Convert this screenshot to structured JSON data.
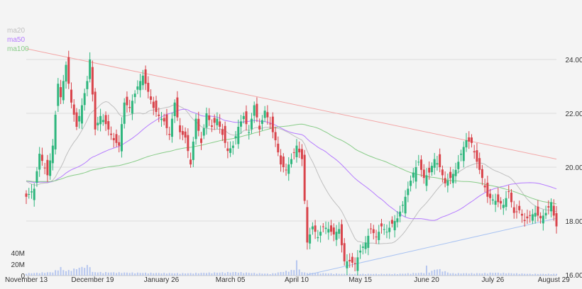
{
  "colors": {
    "background": "#f4f4f4",
    "grid": "#dddddd",
    "up": "#2eb67d",
    "down": "#d9444b",
    "ma20": "#bfbfbf",
    "ma50": "#b57bff",
    "ma100": "#88cc88",
    "trend_upper": "#f3a6a6",
    "trend_lower": "#a9c3f2",
    "volume": "#b7c7ef",
    "axis_text": "#333333"
  },
  "legend": [
    {
      "label": "ma20",
      "color": "#bfbfbf"
    },
    {
      "label": "ma50",
      "color": "#b57bff"
    },
    {
      "label": "ma100",
      "color": "#88cc88"
    }
  ],
  "chart_data": {
    "type": "candlestick",
    "price_axis": {
      "ticks": [
        "24.00",
        "22.00",
        "20.00",
        "18.00",
        "16.00"
      ],
      "ylim": [
        16,
        24.8
      ],
      "position": "right"
    },
    "volume_axis": {
      "ticks": [
        "40M",
        "20M",
        "0"
      ],
      "ylim": [
        0,
        60
      ]
    },
    "x_axis": {
      "labels": [
        "November 13",
        "December 19",
        "January 26",
        "March 05",
        "April 10",
        "May 15",
        "June 20",
        "July 26",
        "August 29"
      ],
      "label_index": [
        0,
        25,
        51,
        77,
        102,
        126,
        151,
        176,
        199
      ],
      "n_days": 201
    },
    "grid": true,
    "anchors_close": [
      [
        0,
        18.9
      ],
      [
        3,
        19.2
      ],
      [
        5,
        20.5
      ],
      [
        8,
        19.7
      ],
      [
        10,
        20.8
      ],
      [
        12,
        23.1
      ],
      [
        13,
        22.6
      ],
      [
        15,
        23.8
      ],
      [
        17,
        22.4
      ],
      [
        19,
        21.5
      ],
      [
        21,
        22.3
      ],
      [
        23,
        23.2
      ],
      [
        24,
        24.0
      ],
      [
        26,
        21.4
      ],
      [
        28,
        21.9
      ],
      [
        30,
        21.6
      ],
      [
        33,
        21.0
      ],
      [
        35,
        20.8
      ],
      [
        37,
        22.4
      ],
      [
        39,
        22.2
      ],
      [
        42,
        23.0
      ],
      [
        44,
        23.4
      ],
      [
        46,
        22.8
      ],
      [
        48,
        22.2
      ],
      [
        50,
        21.9
      ],
      [
        52,
        21.7
      ],
      [
        54,
        21.2
      ],
      [
        56,
        22.4
      ],
      [
        58,
        21.3
      ],
      [
        60,
        21.1
      ],
      [
        62,
        20.1
      ],
      [
        64,
        21.8
      ],
      [
        66,
        20.9
      ],
      [
        68,
        22.0
      ],
      [
        70,
        21.5
      ],
      [
        72,
        21.8
      ],
      [
        74,
        21.2
      ],
      [
        76,
        20.6
      ],
      [
        78,
        20.8
      ],
      [
        80,
        21.5
      ],
      [
        82,
        21.9
      ],
      [
        84,
        21.3
      ],
      [
        86,
        22.3
      ],
      [
        88,
        21.4
      ],
      [
        90,
        22.1
      ],
      [
        92,
        21.6
      ],
      [
        94,
        21.0
      ],
      [
        96,
        20.1
      ],
      [
        98,
        19.9
      ],
      [
        100,
        20.3
      ],
      [
        102,
        20.8
      ],
      [
        104,
        20.3
      ],
      [
        106,
        17.2
      ],
      [
        108,
        17.8
      ],
      [
        110,
        17.4
      ],
      [
        112,
        17.8
      ],
      [
        114,
        17.7
      ],
      [
        116,
        17.5
      ],
      [
        118,
        17.7
      ],
      [
        120,
        16.5
      ],
      [
        122,
        16.5
      ],
      [
        124,
        16.4
      ],
      [
        126,
        16.9
      ],
      [
        128,
        17.2
      ],
      [
        130,
        17.7
      ],
      [
        132,
        17.4
      ],
      [
        134,
        17.8
      ],
      [
        136,
        17.6
      ],
      [
        138,
        17.9
      ],
      [
        140,
        18.1
      ],
      [
        142,
        18.6
      ],
      [
        144,
        19.2
      ],
      [
        146,
        19.8
      ],
      [
        148,
        20.2
      ],
      [
        150,
        19.6
      ],
      [
        152,
        19.8
      ],
      [
        154,
        20.3
      ],
      [
        156,
        20.0
      ],
      [
        158,
        19.4
      ],
      [
        160,
        19.6
      ],
      [
        162,
        19.9
      ],
      [
        164,
        20.5
      ],
      [
        166,
        21.0
      ],
      [
        168,
        20.9
      ],
      [
        170,
        20.2
      ],
      [
        172,
        19.6
      ],
      [
        174,
        18.9
      ],
      [
        176,
        18.8
      ],
      [
        178,
        18.7
      ],
      [
        180,
        18.6
      ],
      [
        182,
        19.1
      ],
      [
        184,
        18.3
      ],
      [
        186,
        18.4
      ],
      [
        188,
        18.0
      ],
      [
        190,
        18.2
      ],
      [
        192,
        18.3
      ],
      [
        194,
        18.1
      ],
      [
        196,
        18.3
      ],
      [
        198,
        18.7
      ],
      [
        199,
        18.2
      ],
      [
        200,
        17.8
      ]
    ],
    "volume_anchors": [
      [
        0,
        4
      ],
      [
        10,
        6
      ],
      [
        13,
        14
      ],
      [
        14,
        10
      ],
      [
        15,
        8
      ],
      [
        24,
        18
      ],
      [
        25,
        6
      ],
      [
        40,
        5
      ],
      [
        60,
        4
      ],
      [
        79,
        6
      ],
      [
        92,
        3
      ],
      [
        101,
        10
      ],
      [
        102,
        28
      ],
      [
        103,
        10
      ],
      [
        105,
        5
      ],
      [
        120,
        3
      ],
      [
        140,
        3
      ],
      [
        150,
        5
      ],
      [
        151,
        16
      ],
      [
        152,
        6
      ],
      [
        155,
        12
      ],
      [
        160,
        4
      ],
      [
        172,
        4
      ],
      [
        176,
        5
      ],
      [
        190,
        3
      ],
      [
        200,
        3
      ]
    ],
    "trendlines": [
      {
        "name": "upper",
        "from": [
          0,
          24.4
        ],
        "to": [
          200,
          20.3
        ]
      },
      {
        "name": "lower",
        "from": [
          106,
          16.0
        ],
        "to": [
          200,
          18.1
        ]
      }
    ],
    "moving_averages": [
      {
        "name": "ma20",
        "window": 20
      },
      {
        "name": "ma50",
        "window": 50
      },
      {
        "name": "ma100",
        "window": 100
      }
    ]
  }
}
